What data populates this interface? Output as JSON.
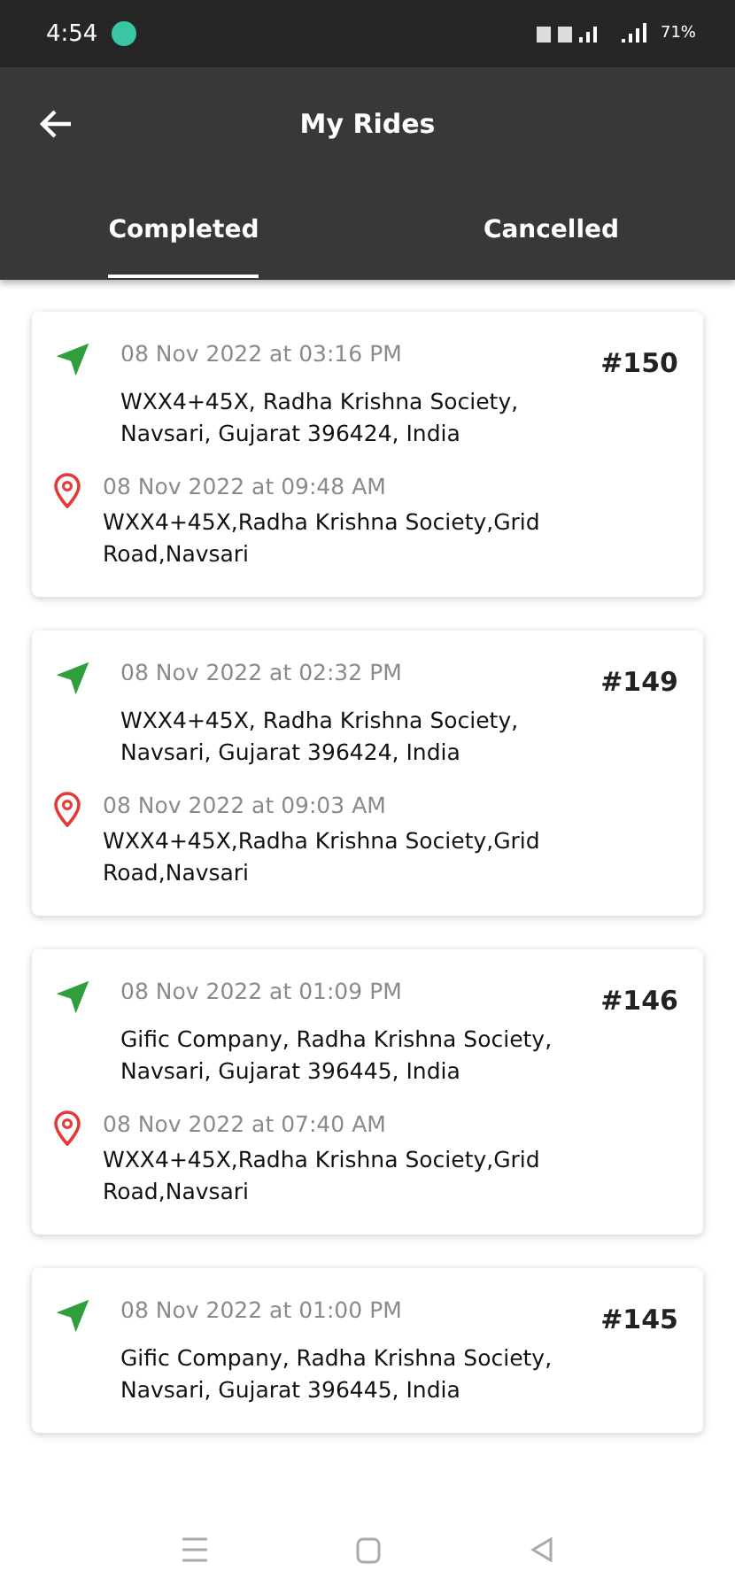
{
  "status_bar": {
    "time": "4:54",
    "battery": "71%"
  },
  "header": {
    "title": "My Rides"
  },
  "tabs": [
    {
      "label": "Completed",
      "selected": true
    },
    {
      "label": "Cancelled",
      "selected": false
    }
  ],
  "rides": [
    {
      "number": "#150",
      "pickup": {
        "time": "08 Nov 2022 at 03:16 PM",
        "address": "WXX4+45X, Radha Krishna Society, Navsari, Gujarat 396424, India"
      },
      "drop": {
        "time": "08 Nov 2022 at 09:48 AM",
        "address": "WXX4+45X,Radha Krishna Society,Grid Road,Navsari"
      }
    },
    {
      "number": "#149",
      "pickup": {
        "time": "08 Nov 2022 at 02:32 PM",
        "address": "WXX4+45X, Radha Krishna Society, Navsari, Gujarat 396424, India"
      },
      "drop": {
        "time": "08 Nov 2022 at 09:03 AM",
        "address": "WXX4+45X,Radha Krishna Society,Grid Road,Navsari"
      }
    },
    {
      "number": "#146",
      "pickup": {
        "time": "08 Nov 2022 at 01:09 PM",
        "address": "Gific Company, Radha Krishna Society, Navsari, Gujarat 396445, India"
      },
      "drop": {
        "time": "08 Nov 2022 at 07:40 AM",
        "address": "WXX4+45X,Radha Krishna Society,Grid Road,Navsari"
      }
    },
    {
      "number": "#145",
      "pickup": {
        "time": "08 Nov 2022 at 01:00 PM",
        "address": "Gific Company, Radha Krishna Society, Navsari, Gujarat 396445, India"
      }
    }
  ]
}
